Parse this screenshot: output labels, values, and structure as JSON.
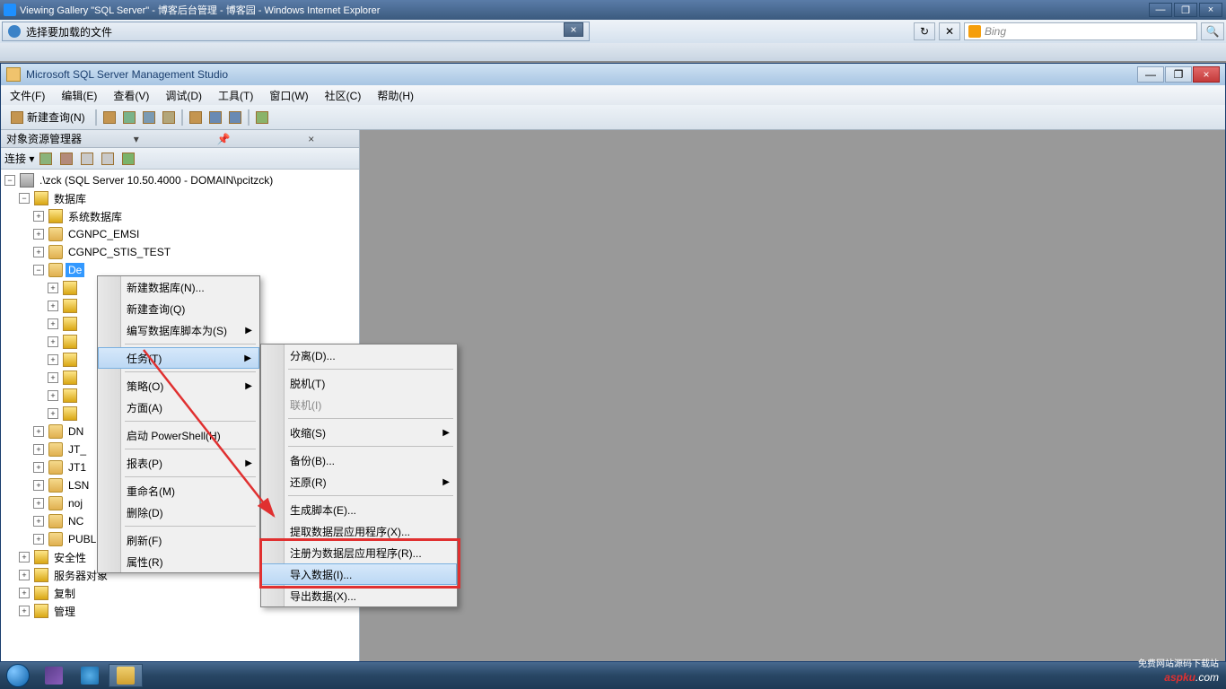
{
  "ie": {
    "title": "Viewing Gallery \"SQL Server\" - 博客后台管理 - 博客园 - Windows Internet Explorer",
    "min": "—",
    "max": "❐",
    "close": "×",
    "dialog_title": "选择要加载的文件",
    "search_placeholder": "Bing"
  },
  "ssms": {
    "title": "Microsoft SQL Server Management Studio",
    "min": "—",
    "max": "❐",
    "close": "×",
    "menus": [
      "文件(F)",
      "编辑(E)",
      "查看(V)",
      "调试(D)",
      "工具(T)",
      "窗口(W)",
      "社区(C)",
      "帮助(H)"
    ],
    "new_query": "新建查询(N)",
    "oe_title": "对象资源管理器",
    "oe_connect": "连接 ▾",
    "server": ".\\zck (SQL Server 10.50.4000 - DOMAIN\\pcitzck)",
    "tree": {
      "db_folder": "数据库",
      "sys_db": "系统数据库",
      "db1": "CGNPC_EMSI",
      "db2": "CGNPC_STIS_TEST",
      "db_sel": "De",
      "dn": "DN",
      "jt": "JT_",
      "jt1": "JT1",
      "lsn": "LSN",
      "noj": "noj",
      "nc": "NC",
      "public": "PUBLIC",
      "security": "安全性",
      "srvobj": "服务器对象",
      "repl": "复制",
      "mgmt": "管理"
    },
    "ctx1": {
      "newdb": "新建数据库(N)...",
      "newq": "新建查询(Q)",
      "script": "编写数据库脚本为(S)",
      "tasks": "任务(T)",
      "strategy": "策略(O)",
      "aspect": "方面(A)",
      "ps": "启动 PowerShell(H)",
      "report": "报表(P)",
      "rename": "重命名(M)",
      "delete": "删除(D)",
      "refresh": "刷新(F)",
      "props": "属性(R)"
    },
    "ctx2": {
      "detach": "分离(D)...",
      "offline": "脱机(T)",
      "online": "联机(I)",
      "shrink": "收缩(S)",
      "backup": "备份(B)...",
      "restore": "还原(R)",
      "genscript": "生成脚本(E)...",
      "extract": "提取数据层应用程序(X)...",
      "register": "注册为数据层应用程序(R)...",
      "import": "导入数据(I)...",
      "export": "导出数据(X)..."
    }
  },
  "watermark": {
    "brand_red": "aspku",
    "brand_rest": ".com",
    "sub": "免费网站源码下载站"
  }
}
